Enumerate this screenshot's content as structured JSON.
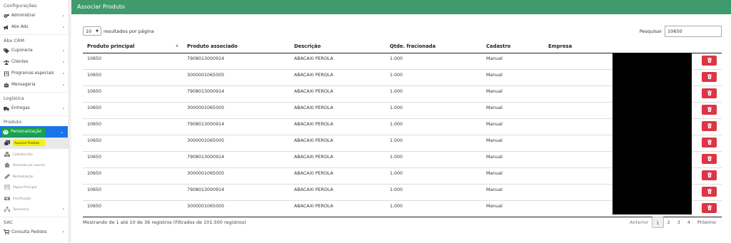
{
  "sidebar": {
    "sections": [
      {
        "title": "Configurações",
        "items": [
          {
            "label": "Administrar",
            "icon": "cogs-icon",
            "chevron": "‹"
          },
          {
            "label": "Abx Ads",
            "icon": "megaphone-icon",
            "chevron": "‹"
          }
        ]
      },
      {
        "title": "Abx CRM",
        "items": [
          {
            "label": "Cuponeria",
            "icon": "tag-icon",
            "chevron": "‹"
          },
          {
            "label": "Clientes",
            "icon": "users-icon",
            "chevron": "‹"
          },
          {
            "label": "Programas especiais",
            "icon": "book-icon",
            "chevron": "‹"
          },
          {
            "label": "Mensageria",
            "icon": "robot-icon",
            "chevron": "‹"
          }
        ]
      },
      {
        "title": "Logística",
        "items": [
          {
            "label": "Entregas",
            "icon": "truck-icon",
            "chevron": "‹"
          }
        ]
      },
      {
        "title": "Produto"
      }
    ],
    "active_menu": {
      "label": "Personalização",
      "icon": "palette-icon",
      "chevron": "⌄"
    },
    "submenu": [
      {
        "label": "Associar Produto",
        "icon": "clone-icon"
      },
      {
        "label": "Cadastro Kits",
        "icon": "boxes-icon"
      },
      {
        "label": "Desconto por volume",
        "icon": "percent-icon"
      },
      {
        "label": "Normalização",
        "icon": "pencil-icon"
      },
      {
        "label": "Página Principal",
        "icon": "page-icon"
      },
      {
        "label": "Precificação",
        "icon": "money-icon"
      },
      {
        "label": "Taxonomia",
        "icon": "tree-icon",
        "chevron": "‹"
      }
    ],
    "sac": {
      "title": "SAC",
      "item": {
        "label": "Consulta Pedidos",
        "icon": "cart-icon",
        "chevron": "‹"
      }
    }
  },
  "panel": {
    "title": "Associar Produto",
    "length_value": "10",
    "length_label": "resultados por página",
    "search_label": "Pesquisar",
    "search_value": "10650"
  },
  "table": {
    "headers": [
      "Produto principal",
      "Produto associado",
      "Descrição",
      "Qtde. fracionada",
      "Cadastro",
      "Empresa",
      ""
    ],
    "rows": [
      [
        "10650",
        "7908013000914",
        "ABACAXI PEROLA",
        "1.000",
        "Manual"
      ],
      [
        "10650",
        "3000001065005",
        "ABACAXI PEROLA",
        "1.000",
        "Manual"
      ],
      [
        "10650",
        "7908013000914",
        "ABACAXI PEROLA",
        "1.000",
        "Manual"
      ],
      [
        "10650",
        "3000001065005",
        "ABACAXI PEROLA",
        "1.000",
        "Manual"
      ],
      [
        "10650",
        "7908013000914",
        "ABACAXI PEROLA",
        "1.000",
        "Manual"
      ],
      [
        "10650",
        "3000001065005",
        "ABACAXI PEROLA",
        "1.000",
        "Manual"
      ],
      [
        "10650",
        "7908013000914",
        "ABACAXI PEROLA",
        "1.000",
        "Manual"
      ],
      [
        "10650",
        "3000001065005",
        "ABACAXI PEROLA",
        "1.000",
        "Manual"
      ],
      [
        "10650",
        "7908013000914",
        "ABACAXI PEROLA",
        "1.000",
        "Manual"
      ],
      [
        "10650",
        "3000001065005",
        "ABACAXI PEROLA",
        "1.000",
        "Manual"
      ]
    ]
  },
  "footer": {
    "info": "Mostrando de 1 até 10 de 36 registros (Filtrados de 101.500 registros)",
    "prev": "Anterior",
    "pages": [
      "1",
      "2",
      "3",
      "4"
    ],
    "current_page": "1",
    "next": "Próximo"
  },
  "colors": {
    "header_green": "#3f9b6b",
    "active_blue": "#1a73e8",
    "highlight_green": "#16a34a",
    "highlight_yellow": "#f2f20a",
    "delete_red": "#dc3545"
  }
}
